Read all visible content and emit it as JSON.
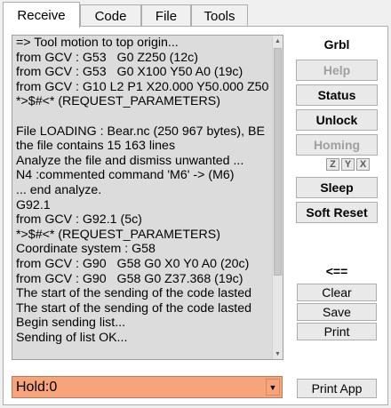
{
  "tabs": [
    {
      "label": "Receive",
      "active": true
    },
    {
      "label": "Code",
      "active": false
    },
    {
      "label": "File",
      "active": false
    },
    {
      "label": "Tools",
      "active": false
    }
  ],
  "log": {
    "lines": [
      "=> Tool motion to top origin...",
      "from GCV : G53   G0 Z250 (12c)",
      "from GCV : G53   G0 X100 Y50 A0 (19c)",
      "from GCV : G10 L2 P1 X20.000 Y50.000 Z50",
      "*>$#<* (REQUEST_PARAMETERS)",
      "",
      "File LOADING : Bear.nc (250 967 bytes), BE",
      "the file contains 15 163 lines",
      "Analyze the file and dismiss unwanted ...",
      "N4 :commented command 'M6' -> (M6)",
      "... end analyze.",
      "G92.1",
      "from GCV : G92.1 (5c)",
      "*>$#<* (REQUEST_PARAMETERS)",
      "Coordinate system : G58",
      "from GCV : G90   G58 G0 X0 Y0 A0 (20c)",
      "from GCV : G90   G58 G0 Z37.368 (19c)",
      "The start of the sending of the code lasted",
      "The start of the sending of the code lasted",
      "Begin sending list...",
      "Sending of list OK..."
    ]
  },
  "panel": {
    "title": "Grbl",
    "help": "Help",
    "status": "Status",
    "unlock": "Unlock",
    "homing": "Homing",
    "axis_z": "Z",
    "axis_y": "Y",
    "axis_x": "X",
    "sleep": "Sleep",
    "soft_reset": "Soft Reset",
    "arrow": "<==",
    "clear": "Clear",
    "save": "Save",
    "print": "Print",
    "print_app": "Print App"
  },
  "hold": {
    "value": "Hold:0",
    "color": "#f8a47b"
  }
}
